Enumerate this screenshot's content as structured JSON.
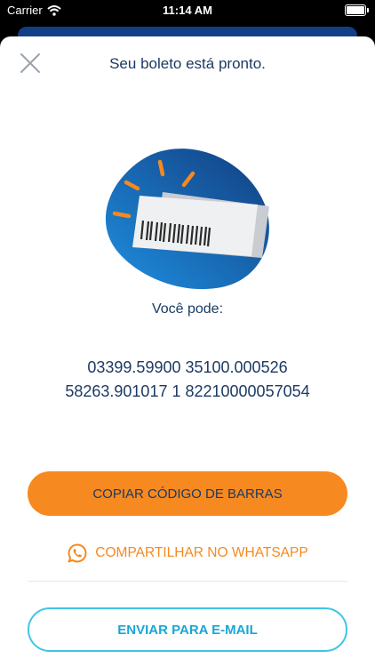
{
  "status_bar": {
    "carrier": "Carrier",
    "time": "11:14 AM"
  },
  "header": {
    "title": "Seu boleto está pronto."
  },
  "content": {
    "subtitle": "Você pode:",
    "barcode_line1": "03399.59900 35100.000526",
    "barcode_line2": "58263.901017 1 82210000057054"
  },
  "actions": {
    "copy_label": "COPIAR CÓDIGO DE BARRAS",
    "whatsapp_label": "COMPARTILHAR NO WHATSAPP",
    "email_label": "ENVIAR PARA E-MAIL"
  },
  "colors": {
    "primary": "#1c3a63",
    "accent": "#f6891f",
    "email": "#19a6d8",
    "blob": "#1a73c7"
  },
  "icons": {
    "close": "close-icon",
    "whatsapp": "whatsapp-icon",
    "illustration": "barcode-ticket-illustration"
  }
}
